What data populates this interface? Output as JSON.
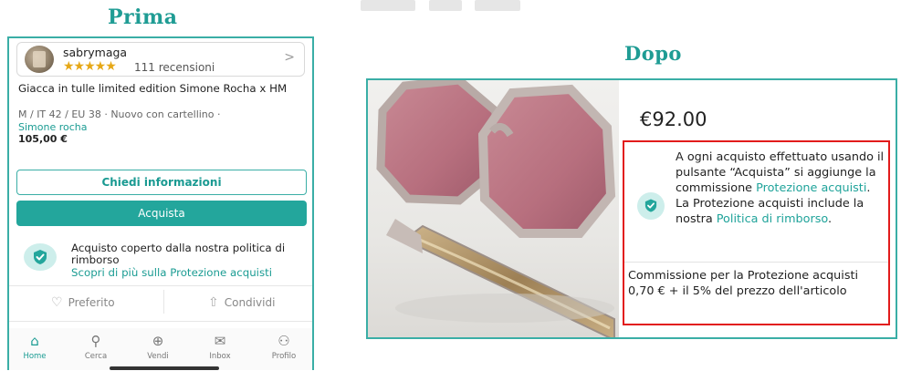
{
  "headings": {
    "before": "Prima",
    "after": "Dopo"
  },
  "before": {
    "seller": {
      "name": "sabrymaga",
      "stars": "★★★★★",
      "reviews": "111 recensioni"
    },
    "item": {
      "title": "Giacca in tulle limited edition Simone Rocha x HM",
      "meta": "M / IT 42 / EU 38 · Nuovo con cartellino ·",
      "brand": "Simone rocha",
      "price": "105,00 €"
    },
    "buttons": {
      "ask": "Chiedi informazioni",
      "buy": "Acquista"
    },
    "protection": {
      "text": "Acquisto coperto dalla nostra politica di rimborso",
      "link": "Scopri di più sulla Protezione acquisti"
    },
    "actions": {
      "favorite": "Preferito",
      "share": "Condividi"
    },
    "tabs": [
      {
        "label": "Home",
        "icon": "home-icon"
      },
      {
        "label": "Cerca",
        "icon": "search-icon"
      },
      {
        "label": "Vendi",
        "icon": "plus-circle-icon"
      },
      {
        "label": "Inbox",
        "icon": "mail-icon"
      },
      {
        "label": "Profilo",
        "icon": "profile-icon"
      }
    ]
  },
  "after": {
    "price": "€92.00",
    "info": {
      "t1": "A ogni acquisto effettuato usando il pulsante “Acquista” si aggiunge la commissione ",
      "link1": "Protezione acquisti",
      "t2": ". La Protezione acquisti include la nostra ",
      "link2": "Politica di rimborso",
      "t3": "."
    },
    "fee": {
      "label": "Commissione per la Protezione acquisti",
      "value": "0,70 € + il 5% del prezzo dell'articolo"
    }
  },
  "colors": {
    "accent": "#23a69c",
    "highlight_border": "#e21b1b"
  }
}
